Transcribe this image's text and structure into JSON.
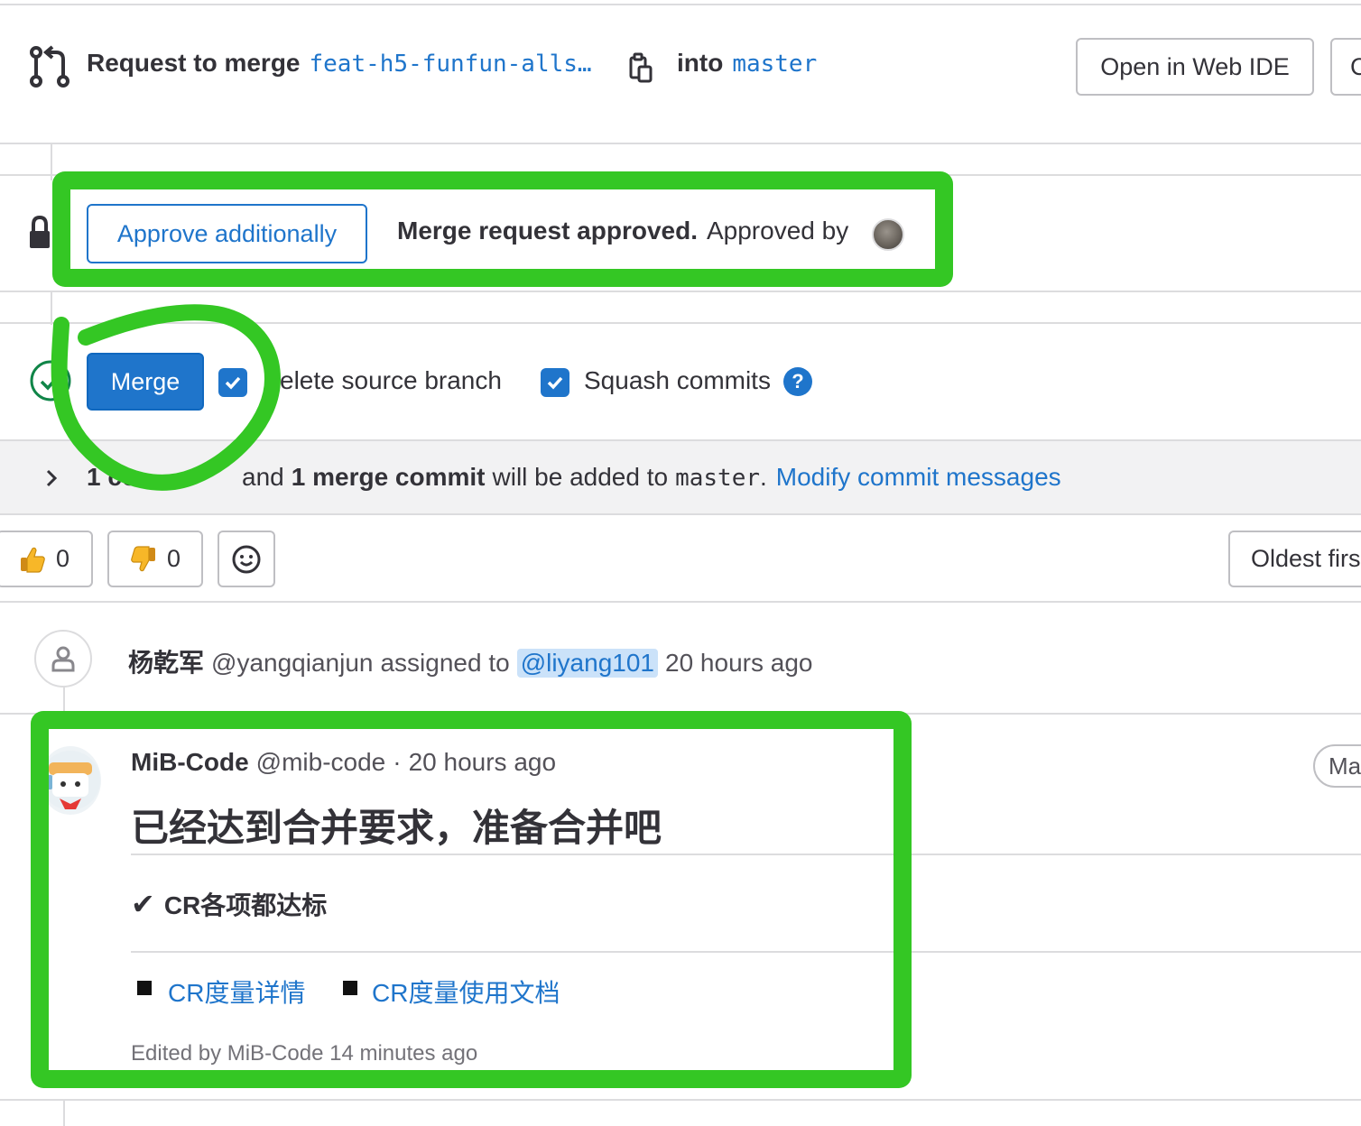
{
  "header": {
    "request_label": "Request to merge",
    "source_branch": "feat-h5-funfun-alls…",
    "into_label": "into",
    "target_branch": "master",
    "open_web_ide": "Open in Web IDE",
    "next_button_partial": "C"
  },
  "approval": {
    "approve_button": "Approve additionally",
    "approved_bold": "Merge request approved.",
    "approved_by": "Approved by"
  },
  "merge": {
    "merge_button": "Merge",
    "delete_source_label": "elete source branch",
    "squash_label": "Squash commits",
    "help_symbol": "?"
  },
  "commit_info": {
    "count_bold": "1 co",
    "middle": "and",
    "merge_commit_bold": "1 merge commit",
    "will_be_added": "will be added to",
    "target": "master",
    "period": ".",
    "modify_link": "Modify commit messages"
  },
  "reactions": {
    "thumbs_up_count": "0",
    "thumbs_down_count": "0",
    "sort_button": "Oldest firs"
  },
  "activity": {
    "author_name": "杨乾军",
    "author_handle": "@yangqianjun",
    "action": "assigned to",
    "assignee": "@liyang101",
    "time": "20 hours ago"
  },
  "comment": {
    "author_name": "MiB-Code",
    "author_handle": "@mib-code",
    "separator": "·",
    "time": "20 hours ago",
    "title": "已经达到合并要求，准备合并吧",
    "check_mark": "✔",
    "check_text": "CR各项都达标",
    "link1": "CR度量详情",
    "link2": "CR度量使用文档",
    "edited": "Edited by MiB-Code 14 minutes ago",
    "role_badge_partial": "Mai"
  },
  "colors": {
    "accent_blue": "#1f75cb",
    "annotation_green": "#34c724",
    "border_gray": "#dcdcde"
  }
}
